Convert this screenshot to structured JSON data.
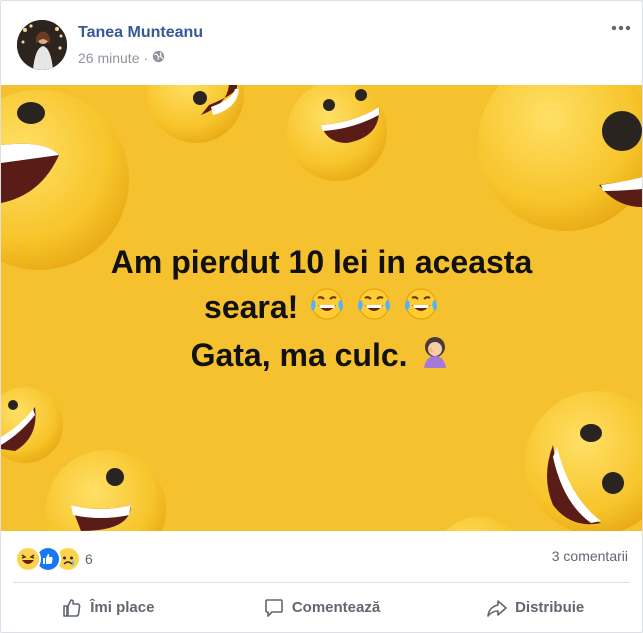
{
  "post": {
    "author": "Tanea Munteanu",
    "time": "26 minute",
    "separator": "·",
    "audience_icon": "globe-icon",
    "menu_icon": "more-options-icon",
    "image_text": {
      "line1": "Am pierdut 10 lei in aceasta",
      "line2": "seara!",
      "line3": "Gata, ma culc."
    },
    "reactions": {
      "types": [
        "haha",
        "like",
        "sad"
      ],
      "count": "6"
    },
    "comments_label": "3 comentarii",
    "actions": {
      "like": "Îmi place",
      "comment": "Comentează",
      "share": "Distribuie"
    }
  },
  "colors": {
    "author": "#385898",
    "background_yellow": "#f6c12e",
    "like_blue": "#1877f2"
  }
}
